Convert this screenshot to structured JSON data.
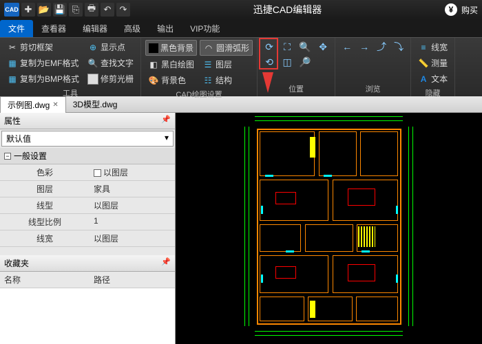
{
  "app": {
    "title": "迅捷CAD编辑器",
    "buy": "购买"
  },
  "qat": {
    "cad": "CAD"
  },
  "tabs": [
    "文件",
    "查看器",
    "编辑器",
    "高级",
    "输出",
    "VIP功能"
  ],
  "ribbon": {
    "tools": {
      "label": "工具",
      "clip_frame": "剪切框架",
      "copy_emf": "复制为EMF格式",
      "copy_bmp": "复制为BMP格式",
      "show_point": "显示点",
      "find_text": "查找文字",
      "trim_clipboard": "修剪光栅"
    },
    "draw_settings": {
      "label": "CAD绘图设置",
      "black_bg": "黑色背景",
      "bw_draw": "黑白绘图",
      "bg_color": "背景色",
      "smooth_arc": "圆滑弧形",
      "layers": "图层",
      "structure": "结构"
    },
    "position": {
      "label": "位置"
    },
    "browse": {
      "label": "浏览"
    },
    "hide": {
      "label": "隐藏",
      "linewidth": "线宽",
      "measure": "测量",
      "text": "文本"
    }
  },
  "doc_tabs": [
    {
      "name": "示例图.dwg",
      "active": true
    },
    {
      "name": "3D模型.dwg",
      "active": false
    }
  ],
  "props": {
    "title": "属性",
    "default": "默认值",
    "general": "一般设置",
    "rows": [
      {
        "k": "色彩",
        "v": "以图层",
        "chk": true
      },
      {
        "k": "图层",
        "v": "家具"
      },
      {
        "k": "线型",
        "v": "以图层"
      },
      {
        "k": "线型比例",
        "v": "1"
      },
      {
        "k": "线宽",
        "v": "以图层"
      }
    ]
  },
  "favorites": {
    "title": "收藏夹",
    "name": "名称",
    "path": "路径"
  }
}
